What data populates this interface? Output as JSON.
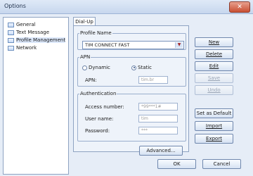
{
  "window": {
    "title": "Options",
    "close_label": "✕"
  },
  "sidebar": {
    "items": [
      {
        "label": "General",
        "icon": "folder-icon"
      },
      {
        "label": "Text Message",
        "icon": "folder-icon"
      },
      {
        "label": "Profile Management",
        "icon": "folder-icon"
      },
      {
        "label": "Network",
        "icon": "folder-icon"
      }
    ]
  },
  "tabs": [
    {
      "label": "Dial-Up"
    }
  ],
  "profile": {
    "legend": "Profile Name",
    "selected": "TIM CONNECT FAST"
  },
  "apn": {
    "legend": "APN",
    "options": [
      "Dynamic",
      "Static"
    ],
    "selected": "Static",
    "label": "APN:",
    "value": "tim.br"
  },
  "auth": {
    "legend": "Authentication",
    "access_number_label": "Access number:",
    "access_number_value": "*99***1#",
    "user_name_label": "User name:",
    "user_name_value": "tim",
    "password_label": "Password:",
    "password_value": "***"
  },
  "buttons": {
    "new": "New",
    "delete": "Delete",
    "edit": "Edit",
    "save": "Save",
    "undo": "Undo",
    "set_default": "Set as Default",
    "import": "Import",
    "export": "Export",
    "advanced": "Advanced...",
    "ok": "OK",
    "cancel": "Cancel"
  }
}
